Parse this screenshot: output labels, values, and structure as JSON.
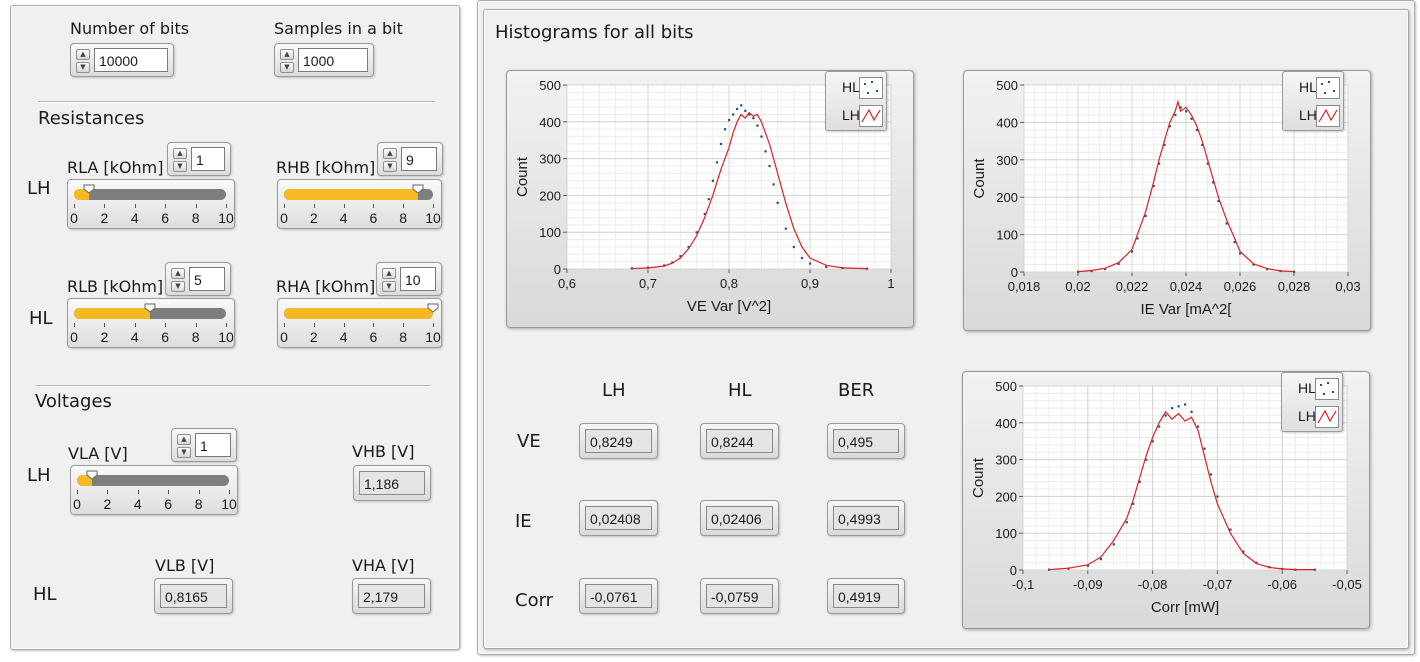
{
  "left": {
    "bits": {
      "label": "Number of bits",
      "value": "10000"
    },
    "samples": {
      "label": "Samples in a bit",
      "value": "1000"
    },
    "resistances_title": "Resistances",
    "voltages_title": "Voltages",
    "lh_label": "LH",
    "hl_label": "HL",
    "slider_ticks": [
      "0",
      "2",
      "4",
      "6",
      "8",
      "10"
    ],
    "rla": {
      "label": "RLA [kOhm]",
      "value": "1",
      "level": 1
    },
    "rhb": {
      "label": "RHB [kOhm]",
      "value": "9",
      "level": 9
    },
    "rlb": {
      "label": "RLB [kOhm]",
      "value": "5",
      "level": 5
    },
    "rha": {
      "label": "RHA [kOhm]",
      "value": "10",
      "level": 10
    },
    "vla": {
      "label": "VLA [V]",
      "value": "1",
      "level": 1
    },
    "vhb": {
      "label": "VHB [V]",
      "value": "1,186"
    },
    "vlb": {
      "label": "VLB [V]",
      "value": "0,8165"
    },
    "vha": {
      "label": "VHA [V]",
      "value": "2,179"
    }
  },
  "right": {
    "title": "Histograms for all bits",
    "legend": {
      "hl": "HL",
      "lh": "LH"
    },
    "series_colors": {
      "hl": "#1f4e9a",
      "lh": "#e02020"
    },
    "table": {
      "col_headers": [
        "LH",
        "HL",
        "BER"
      ],
      "rows": [
        {
          "label": "VE",
          "values": [
            "0,8249",
            "0,8244",
            "0,495"
          ]
        },
        {
          "label": "IE",
          "values": [
            "0,02408",
            "0,02406",
            "0,4993"
          ]
        },
        {
          "label": "Corr",
          "values": [
            "-0,0761",
            "-0,0759",
            "0,4919"
          ]
        }
      ]
    }
  },
  "chart_data": [
    {
      "type": "line",
      "xlabel": "VE Var [V^2]",
      "ylabel": "Count",
      "xlim": [
        0.6,
        1.0
      ],
      "ylim": [
        0,
        500
      ],
      "x_ticks": [
        "0,6",
        "0,7",
        "0,8",
        "0,9",
        "1"
      ],
      "y_ticks": [
        "0",
        "100",
        "200",
        "300",
        "400",
        "500"
      ],
      "series": [
        {
          "name": "HL",
          "style": "points",
          "x": [
            0.68,
            0.7,
            0.72,
            0.73,
            0.74,
            0.75,
            0.76,
            0.77,
            0.775,
            0.78,
            0.785,
            0.79,
            0.795,
            0.8,
            0.805,
            0.81,
            0.815,
            0.82,
            0.825,
            0.83,
            0.835,
            0.84,
            0.845,
            0.85,
            0.855,
            0.86,
            0.87,
            0.88,
            0.89,
            0.9,
            0.92,
            0.94,
            0.97
          ],
          "y": [
            2,
            4,
            10,
            18,
            35,
            60,
            100,
            150,
            190,
            240,
            290,
            340,
            380,
            405,
            420,
            435,
            445,
            430,
            420,
            410,
            390,
            360,
            320,
            280,
            230,
            180,
            110,
            60,
            30,
            15,
            6,
            3,
            1
          ]
        },
        {
          "name": "LH",
          "style": "line",
          "x": [
            0.68,
            0.7,
            0.72,
            0.73,
            0.74,
            0.75,
            0.76,
            0.77,
            0.78,
            0.79,
            0.8,
            0.805,
            0.81,
            0.815,
            0.82,
            0.825,
            0.83,
            0.835,
            0.84,
            0.85,
            0.86,
            0.87,
            0.88,
            0.89,
            0.9,
            0.92,
            0.94,
            0.97
          ],
          "y": [
            1,
            3,
            8,
            16,
            30,
            55,
            90,
            140,
            200,
            270,
            330,
            370,
            400,
            420,
            410,
            425,
            415,
            420,
            400,
            340,
            260,
            180,
            110,
            60,
            30,
            10,
            3,
            1
          ]
        }
      ]
    },
    {
      "type": "line",
      "xlabel": "IE Var [mA^2[",
      "ylabel": "Count",
      "xlim": [
        0.018,
        0.03
      ],
      "ylim": [
        0,
        500
      ],
      "x_ticks": [
        "0,018",
        "0,02",
        "0,022",
        "0,024",
        "0,026",
        "0,028",
        "0,03"
      ],
      "y_ticks": [
        "0",
        "100",
        "200",
        "300",
        "400",
        "500"
      ],
      "series": [
        {
          "name": "HL",
          "style": "points",
          "x": [
            0.02,
            0.0205,
            0.021,
            0.0215,
            0.022,
            0.0222,
            0.0225,
            0.0228,
            0.023,
            0.0232,
            0.0234,
            0.0236,
            0.0238,
            0.024,
            0.0242,
            0.0244,
            0.0246,
            0.0248,
            0.025,
            0.0252,
            0.0255,
            0.0258,
            0.026,
            0.0265,
            0.027,
            0.0275,
            0.028
          ],
          "y": [
            1,
            3,
            8,
            22,
            55,
            90,
            150,
            230,
            290,
            340,
            390,
            420,
            440,
            430,
            410,
            380,
            340,
            290,
            240,
            190,
            130,
            80,
            50,
            20,
            8,
            3,
            1
          ]
        },
        {
          "name": "LH",
          "style": "line",
          "x": [
            0.02,
            0.0205,
            0.021,
            0.0215,
            0.022,
            0.0222,
            0.0225,
            0.0228,
            0.023,
            0.0232,
            0.0234,
            0.0236,
            0.0237,
            0.0238,
            0.024,
            0.0242,
            0.0244,
            0.0246,
            0.0248,
            0.025,
            0.0252,
            0.0255,
            0.0258,
            0.026,
            0.0265,
            0.027,
            0.0275,
            0.028
          ],
          "y": [
            1,
            4,
            10,
            25,
            60,
            100,
            160,
            240,
            300,
            350,
            400,
            430,
            455,
            430,
            440,
            420,
            390,
            350,
            300,
            250,
            200,
            140,
            90,
            55,
            22,
            9,
            3,
            1
          ]
        }
      ]
    },
    {
      "type": "line",
      "xlabel": "Corr [mW]",
      "ylabel": "Count",
      "xlim": [
        -0.1,
        -0.05
      ],
      "ylim": [
        0,
        500
      ],
      "x_ticks": [
        "-0,1",
        "-0,09",
        "-0,08",
        "-0,07",
        "-0,06",
        "-0,05"
      ],
      "y_ticks": [
        "0",
        "100",
        "200",
        "300",
        "400",
        "500"
      ],
      "series": [
        {
          "name": "HL",
          "style": "points",
          "x": [
            -0.096,
            -0.093,
            -0.09,
            -0.088,
            -0.086,
            -0.084,
            -0.083,
            -0.082,
            -0.081,
            -0.08,
            -0.079,
            -0.078,
            -0.077,
            -0.076,
            -0.075,
            -0.074,
            -0.073,
            -0.072,
            -0.071,
            -0.07,
            -0.068,
            -0.066,
            -0.064,
            -0.062,
            -0.06,
            -0.058,
            -0.055
          ],
          "y": [
            1,
            4,
            12,
            30,
            70,
            130,
            180,
            240,
            300,
            350,
            390,
            420,
            440,
            445,
            450,
            430,
            390,
            330,
            260,
            200,
            110,
            50,
            20,
            8,
            3,
            1,
            1
          ]
        },
        {
          "name": "LH",
          "style": "line",
          "x": [
            -0.096,
            -0.093,
            -0.09,
            -0.088,
            -0.086,
            -0.084,
            -0.083,
            -0.082,
            -0.081,
            -0.08,
            -0.079,
            -0.078,
            -0.077,
            -0.076,
            -0.075,
            -0.074,
            -0.073,
            -0.072,
            -0.071,
            -0.07,
            -0.068,
            -0.066,
            -0.064,
            -0.062,
            -0.06,
            -0.058,
            -0.055
          ],
          "y": [
            1,
            5,
            14,
            35,
            80,
            140,
            190,
            250,
            310,
            360,
            400,
            430,
            410,
            425,
            405,
            415,
            380,
            310,
            240,
            180,
            100,
            45,
            18,
            7,
            3,
            1,
            1
          ]
        }
      ]
    }
  ]
}
